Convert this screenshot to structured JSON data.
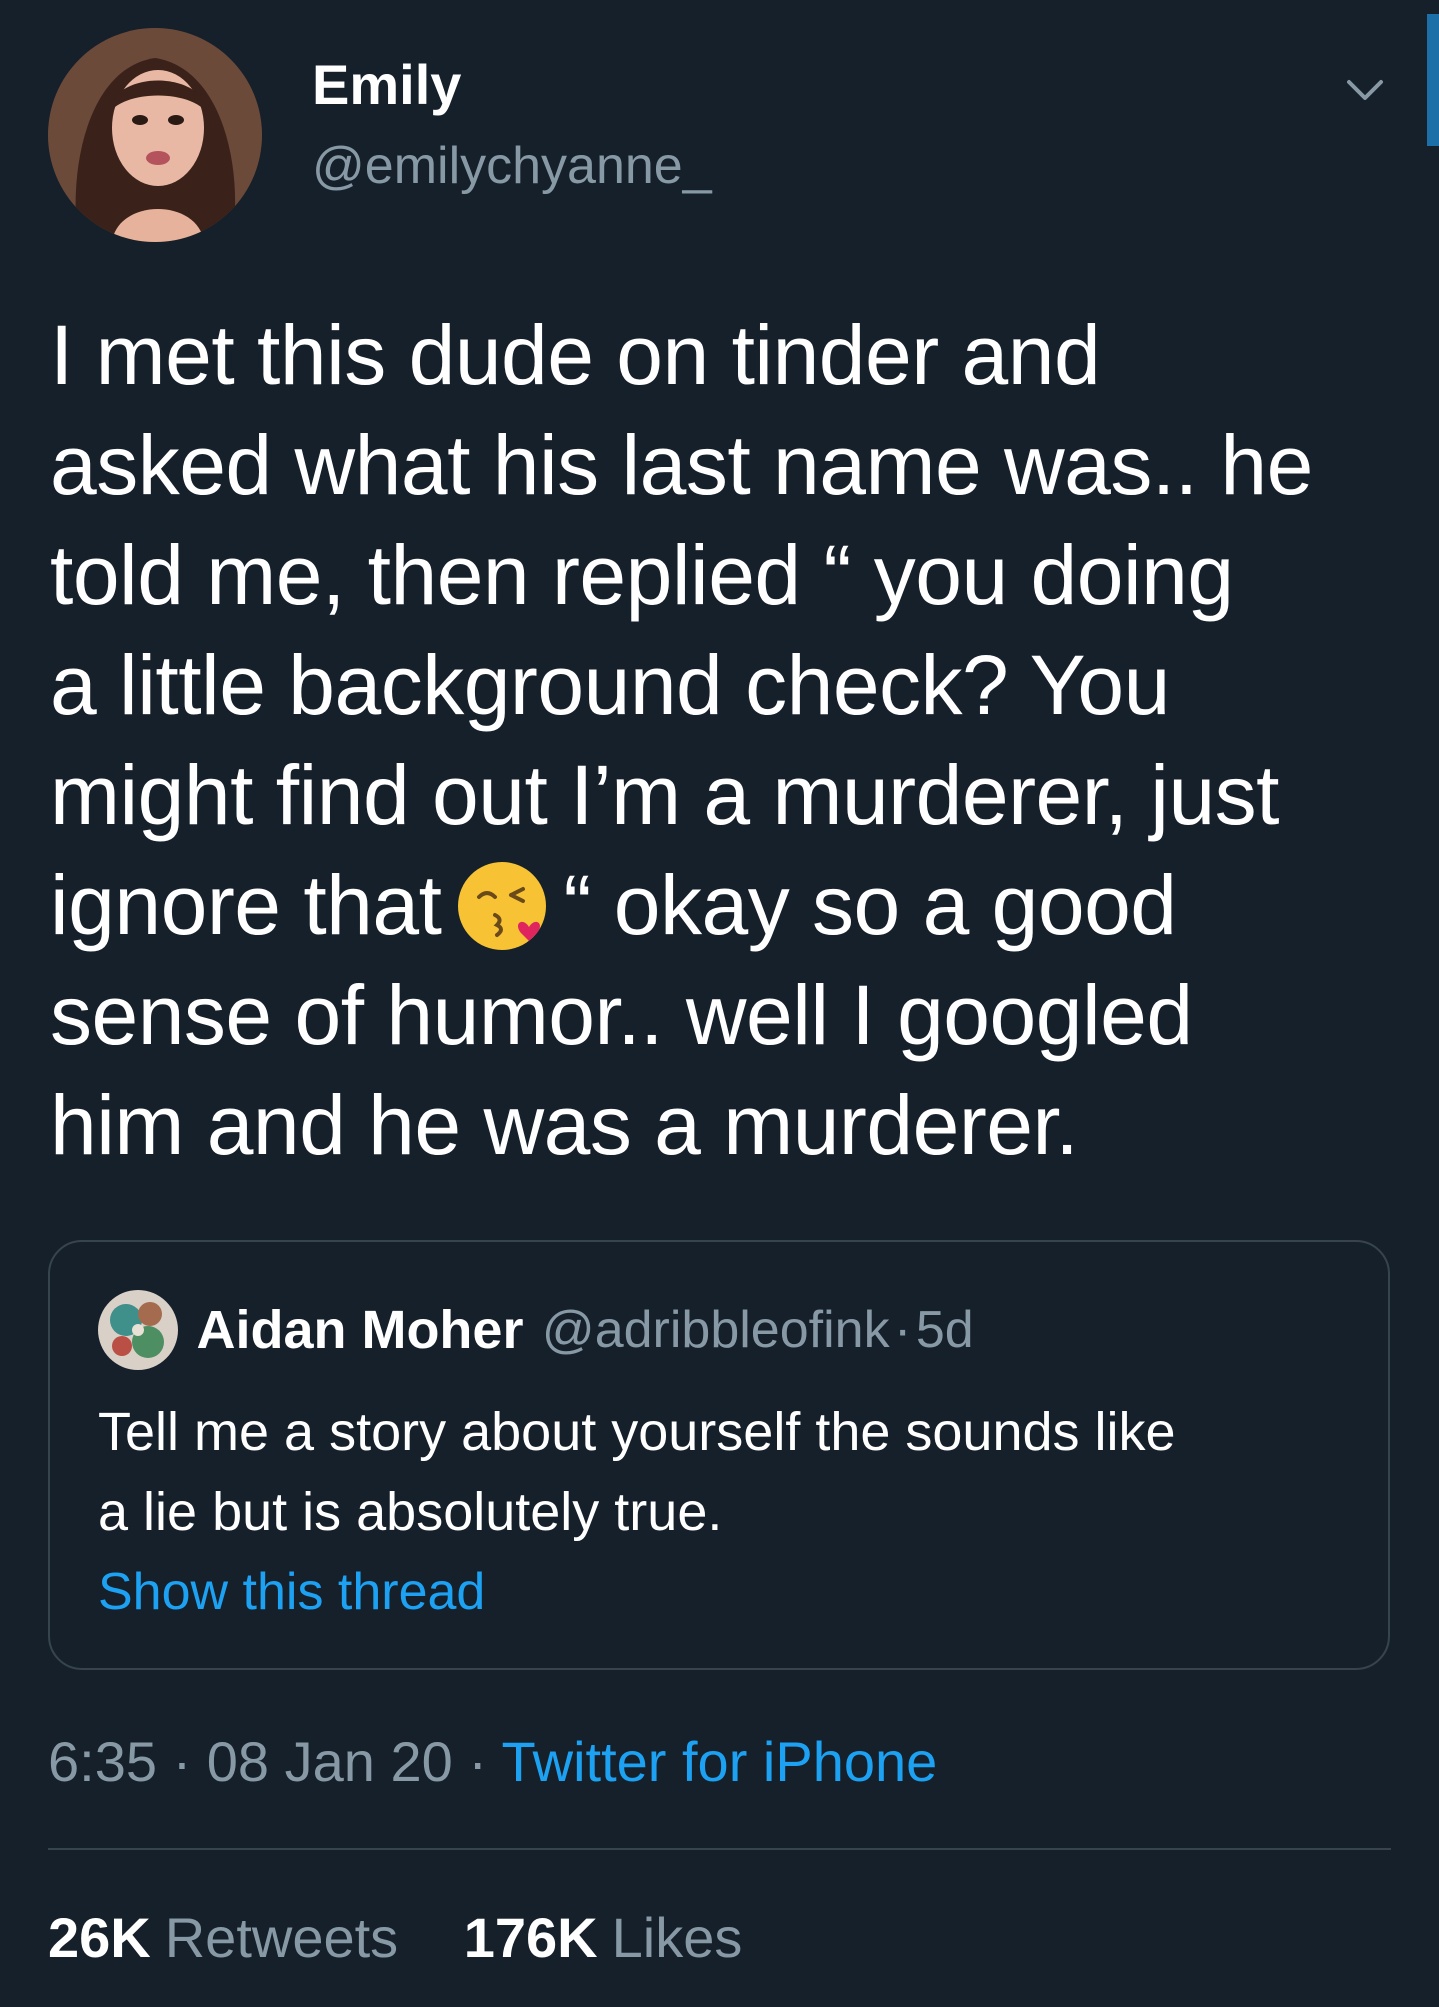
{
  "author": {
    "display_name": "Emily",
    "handle": "@emilychyanne_"
  },
  "tweet": {
    "lines": [
      "I met this dude on tinder and",
      "asked what his last name was.. he",
      "told me, then replied “ you doing",
      "a little background check? You",
      "might find out I’m a murderer, just",
      "ignore that",
      "“ okay so a good",
      "sense of humor.. well I googled",
      "him and he was a murderer."
    ],
    "emoji": "face-blowing-a-kiss"
  },
  "quoted_tweet": {
    "display_name": "Aidan Moher",
    "handle": "@adribbleofink",
    "separator": "·",
    "time": "5d",
    "text_lines": [
      "Tell me a story about yourself the sounds like",
      "a lie but is absolutely true."
    ],
    "link_label": "Show this thread"
  },
  "meta": {
    "time": "6:35",
    "separator": "·",
    "date": "08 Jan 20",
    "source": "Twitter for iPhone"
  },
  "stats": {
    "retweets_count": "26K",
    "retweets_label": "Retweets",
    "likes_count": "176K",
    "likes_label": "Likes"
  },
  "colors": {
    "background": "#15202b",
    "text_primary": "#ffffff",
    "text_secondary": "#8899a6",
    "link": "#1da1f2",
    "border": "#38444d"
  }
}
